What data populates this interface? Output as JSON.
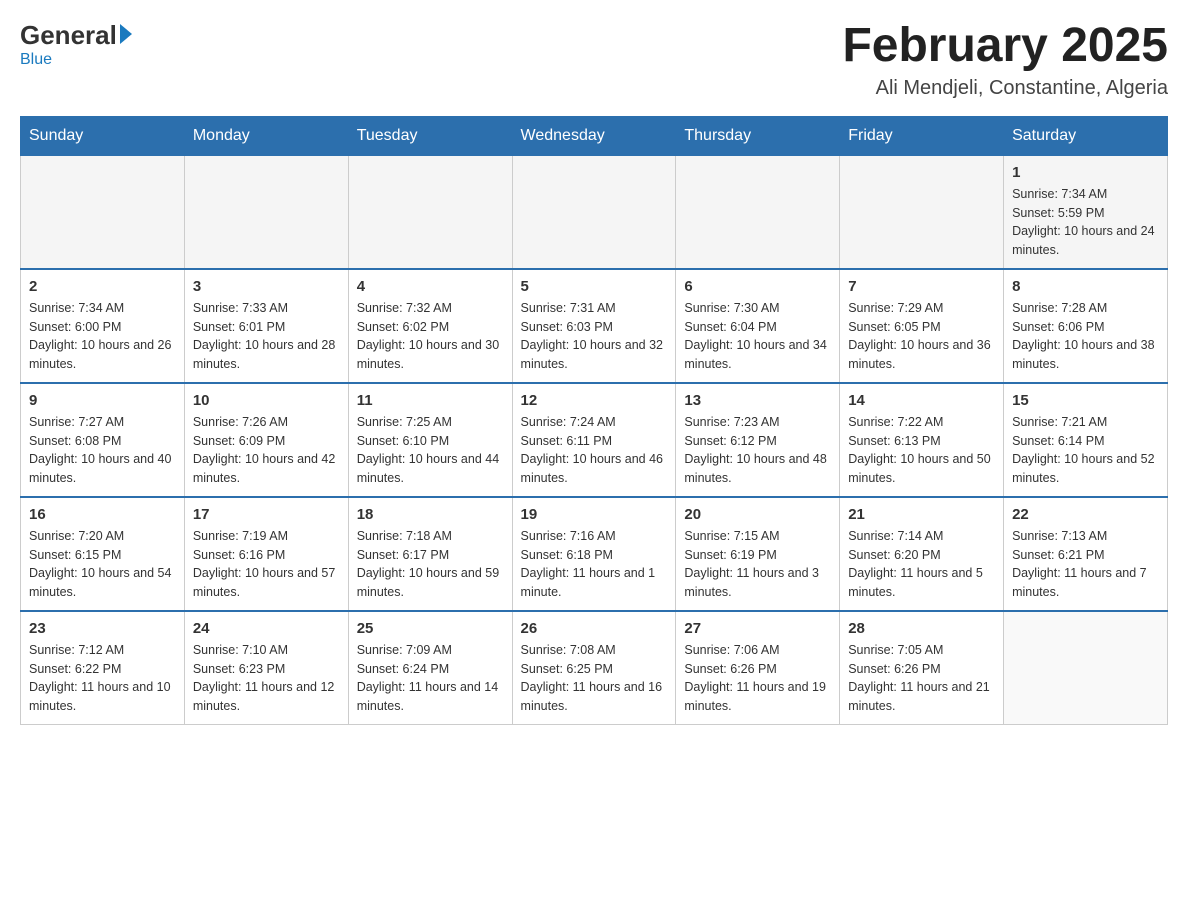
{
  "header": {
    "logo_general": "General",
    "logo_blue": "Blue",
    "title": "February 2025",
    "subtitle": "Ali Mendjeli, Constantine, Algeria"
  },
  "weekdays": [
    "Sunday",
    "Monday",
    "Tuesday",
    "Wednesday",
    "Thursday",
    "Friday",
    "Saturday"
  ],
  "weeks": [
    [
      {
        "day": "",
        "info": ""
      },
      {
        "day": "",
        "info": ""
      },
      {
        "day": "",
        "info": ""
      },
      {
        "day": "",
        "info": ""
      },
      {
        "day": "",
        "info": ""
      },
      {
        "day": "",
        "info": ""
      },
      {
        "day": "1",
        "info": "Sunrise: 7:34 AM\nSunset: 5:59 PM\nDaylight: 10 hours and 24 minutes."
      }
    ],
    [
      {
        "day": "2",
        "info": "Sunrise: 7:34 AM\nSunset: 6:00 PM\nDaylight: 10 hours and 26 minutes."
      },
      {
        "day": "3",
        "info": "Sunrise: 7:33 AM\nSunset: 6:01 PM\nDaylight: 10 hours and 28 minutes."
      },
      {
        "day": "4",
        "info": "Sunrise: 7:32 AM\nSunset: 6:02 PM\nDaylight: 10 hours and 30 minutes."
      },
      {
        "day": "5",
        "info": "Sunrise: 7:31 AM\nSunset: 6:03 PM\nDaylight: 10 hours and 32 minutes."
      },
      {
        "day": "6",
        "info": "Sunrise: 7:30 AM\nSunset: 6:04 PM\nDaylight: 10 hours and 34 minutes."
      },
      {
        "day": "7",
        "info": "Sunrise: 7:29 AM\nSunset: 6:05 PM\nDaylight: 10 hours and 36 minutes."
      },
      {
        "day": "8",
        "info": "Sunrise: 7:28 AM\nSunset: 6:06 PM\nDaylight: 10 hours and 38 minutes."
      }
    ],
    [
      {
        "day": "9",
        "info": "Sunrise: 7:27 AM\nSunset: 6:08 PM\nDaylight: 10 hours and 40 minutes."
      },
      {
        "day": "10",
        "info": "Sunrise: 7:26 AM\nSunset: 6:09 PM\nDaylight: 10 hours and 42 minutes."
      },
      {
        "day": "11",
        "info": "Sunrise: 7:25 AM\nSunset: 6:10 PM\nDaylight: 10 hours and 44 minutes."
      },
      {
        "day": "12",
        "info": "Sunrise: 7:24 AM\nSunset: 6:11 PM\nDaylight: 10 hours and 46 minutes."
      },
      {
        "day": "13",
        "info": "Sunrise: 7:23 AM\nSunset: 6:12 PM\nDaylight: 10 hours and 48 minutes."
      },
      {
        "day": "14",
        "info": "Sunrise: 7:22 AM\nSunset: 6:13 PM\nDaylight: 10 hours and 50 minutes."
      },
      {
        "day": "15",
        "info": "Sunrise: 7:21 AM\nSunset: 6:14 PM\nDaylight: 10 hours and 52 minutes."
      }
    ],
    [
      {
        "day": "16",
        "info": "Sunrise: 7:20 AM\nSunset: 6:15 PM\nDaylight: 10 hours and 54 minutes."
      },
      {
        "day": "17",
        "info": "Sunrise: 7:19 AM\nSunset: 6:16 PM\nDaylight: 10 hours and 57 minutes."
      },
      {
        "day": "18",
        "info": "Sunrise: 7:18 AM\nSunset: 6:17 PM\nDaylight: 10 hours and 59 minutes."
      },
      {
        "day": "19",
        "info": "Sunrise: 7:16 AM\nSunset: 6:18 PM\nDaylight: 11 hours and 1 minute."
      },
      {
        "day": "20",
        "info": "Sunrise: 7:15 AM\nSunset: 6:19 PM\nDaylight: 11 hours and 3 minutes."
      },
      {
        "day": "21",
        "info": "Sunrise: 7:14 AM\nSunset: 6:20 PM\nDaylight: 11 hours and 5 minutes."
      },
      {
        "day": "22",
        "info": "Sunrise: 7:13 AM\nSunset: 6:21 PM\nDaylight: 11 hours and 7 minutes."
      }
    ],
    [
      {
        "day": "23",
        "info": "Sunrise: 7:12 AM\nSunset: 6:22 PM\nDaylight: 11 hours and 10 minutes."
      },
      {
        "day": "24",
        "info": "Sunrise: 7:10 AM\nSunset: 6:23 PM\nDaylight: 11 hours and 12 minutes."
      },
      {
        "day": "25",
        "info": "Sunrise: 7:09 AM\nSunset: 6:24 PM\nDaylight: 11 hours and 14 minutes."
      },
      {
        "day": "26",
        "info": "Sunrise: 7:08 AM\nSunset: 6:25 PM\nDaylight: 11 hours and 16 minutes."
      },
      {
        "day": "27",
        "info": "Sunrise: 7:06 AM\nSunset: 6:26 PM\nDaylight: 11 hours and 19 minutes."
      },
      {
        "day": "28",
        "info": "Sunrise: 7:05 AM\nSunset: 6:26 PM\nDaylight: 11 hours and 21 minutes."
      },
      {
        "day": "",
        "info": ""
      }
    ]
  ]
}
